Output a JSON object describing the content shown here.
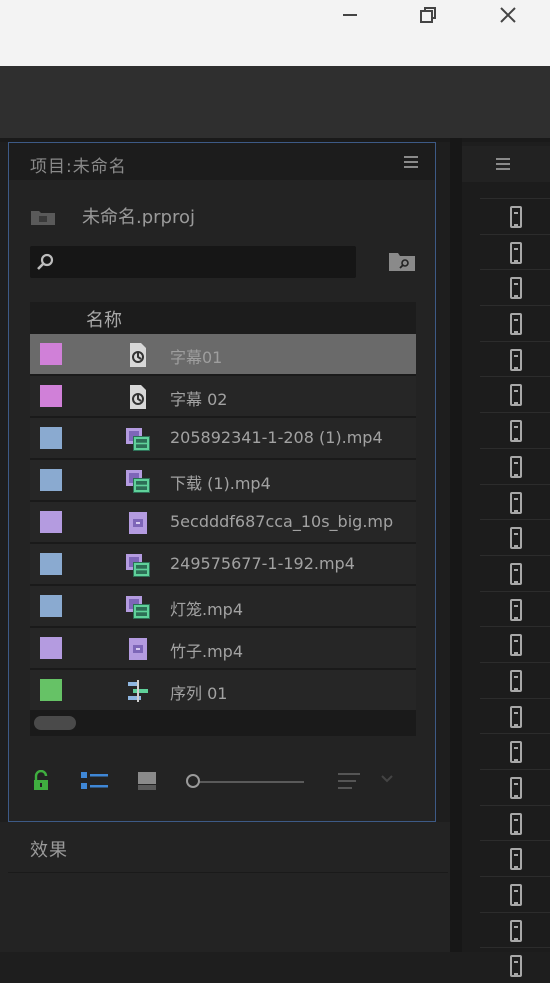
{
  "window": {
    "minimize": "—",
    "restore": "⧉",
    "close": "✕"
  },
  "project_panel": {
    "title": "项目:未命名",
    "project_file": "未命名.prproj",
    "search": {
      "value": "",
      "placeholder": ""
    },
    "column_header": "名称",
    "items": [
      {
        "label": "字幕01",
        "swatch": "#d080d8",
        "icon": "title-icon",
        "selected": true
      },
      {
        "label": "字幕 02",
        "swatch": "#d080d8",
        "icon": "title-icon",
        "selected": false
      },
      {
        "label": "205892341-1-208 (1).mp4",
        "swatch": "#8aaad0",
        "icon": "video-audio-icon",
        "selected": false
      },
      {
        "label": "下载 (1).mp4",
        "swatch": "#8aaad0",
        "icon": "video-audio-icon",
        "selected": false
      },
      {
        "label": "5ecdddf687cca_10s_big.mp",
        "swatch": "#b49be0",
        "icon": "video-icon",
        "selected": false
      },
      {
        "label": "249575677-1-192.mp4",
        "swatch": "#8aaad0",
        "icon": "video-audio-icon",
        "selected": false
      },
      {
        "label": "灯笼.mp4",
        "swatch": "#8aaad0",
        "icon": "video-audio-icon",
        "selected": false
      },
      {
        "label": "竹子.mp4",
        "swatch": "#b49be0",
        "icon": "video-icon",
        "selected": false
      },
      {
        "label": "序列 01",
        "swatch": "#66c266",
        "icon": "sequence-icon",
        "selected": false
      }
    ],
    "toolbar": {
      "lock_color": "#3fae3f",
      "list_view_color": "#3f87d6"
    }
  },
  "effects_panel": {
    "title": "效果"
  },
  "accent_colors": {
    "panel_focus_border": "#3d5a86"
  }
}
